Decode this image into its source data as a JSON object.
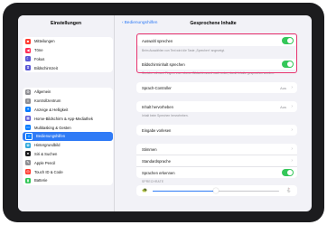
{
  "sidebar": {
    "title": "Einstellungen",
    "groups": [
      {
        "items": [
          {
            "label": "Mitteilungen",
            "icon": "bell-icon",
            "color": "#ff3b30"
          },
          {
            "label": "Töne",
            "icon": "speaker-icon",
            "color": "#ff2d55"
          },
          {
            "label": "Fokus",
            "icon": "moon-icon",
            "color": "#5856d6"
          },
          {
            "label": "Bildschirmzeit",
            "icon": "hourglass-icon",
            "color": "#5856d6"
          }
        ]
      },
      {
        "items": [
          {
            "label": "Allgemein",
            "icon": "gear-icon",
            "color": "#8e8e93"
          },
          {
            "label": "Kontrollzentrum",
            "icon": "switches-icon",
            "color": "#8e8e93"
          },
          {
            "label": "Anzeige & Helligkeit",
            "icon": "sun-icon",
            "color": "#007aff"
          },
          {
            "label": "Home-Bildschirm & App-Mediathek",
            "icon": "grid-icon",
            "color": "#5856d6"
          },
          {
            "label": "Multitasking & Gesten",
            "icon": "multitask-icon",
            "color": "#007aff"
          },
          {
            "label": "Bedienungshilfen",
            "icon": "accessibility-icon",
            "color": "#007aff",
            "selected": true
          },
          {
            "label": "Hintergrundbild",
            "icon": "flower-icon",
            "color": "#34aadc"
          },
          {
            "label": "Siri & Suchen",
            "icon": "siri-icon",
            "color": "#1c1c1e"
          },
          {
            "label": "Apple Pencil",
            "icon": "pencil-icon",
            "color": "#8e8e93"
          },
          {
            "label": "Touch ID & Code",
            "icon": "fingerprint-icon",
            "color": "#ff3b30"
          },
          {
            "label": "Batterie",
            "icon": "battery-icon",
            "color": "#34c759"
          }
        ]
      }
    ]
  },
  "header": {
    "back_label": "Bedienungshilfen",
    "title": "Gesprochene Inhalte"
  },
  "main": {
    "auswahl": {
      "label": "Auswahl sprechen",
      "on": true
    },
    "auswahl_note": "Beim Auswählen von Text wird die Taste „Sprechen“ angezeigt.",
    "bildschirm": {
      "label": "Bildschirminhalt sprechen",
      "on": true
    },
    "bildschirm_note": "Streiche mit zwei Fingern vom oberen Bildschirmrand nach unten, damit Inhalte gesprochen werden.",
    "sprach_controller": {
      "label": "Sprach-Controller",
      "value": "Aus"
    },
    "inhalt": {
      "label": "Inhalt hervorheben",
      "value": "Aus"
    },
    "inhalt_note": "Inhalt beim Sprechen hervorheben.",
    "eingabe": {
      "label": "Eingabe vorlesen"
    },
    "stimmen": {
      "label": "Stimmen"
    },
    "standardsprache": {
      "label": "Standardsprache"
    },
    "sprachen_erkennen": {
      "label": "Sprachen erkennen",
      "on": true
    },
    "speed_header": "SPRECHRATE",
    "speed_rate": 0.5
  },
  "colors": {
    "accent": "#2f7bf6",
    "toggle_on": "#34c759",
    "highlight": "#e8326e"
  }
}
